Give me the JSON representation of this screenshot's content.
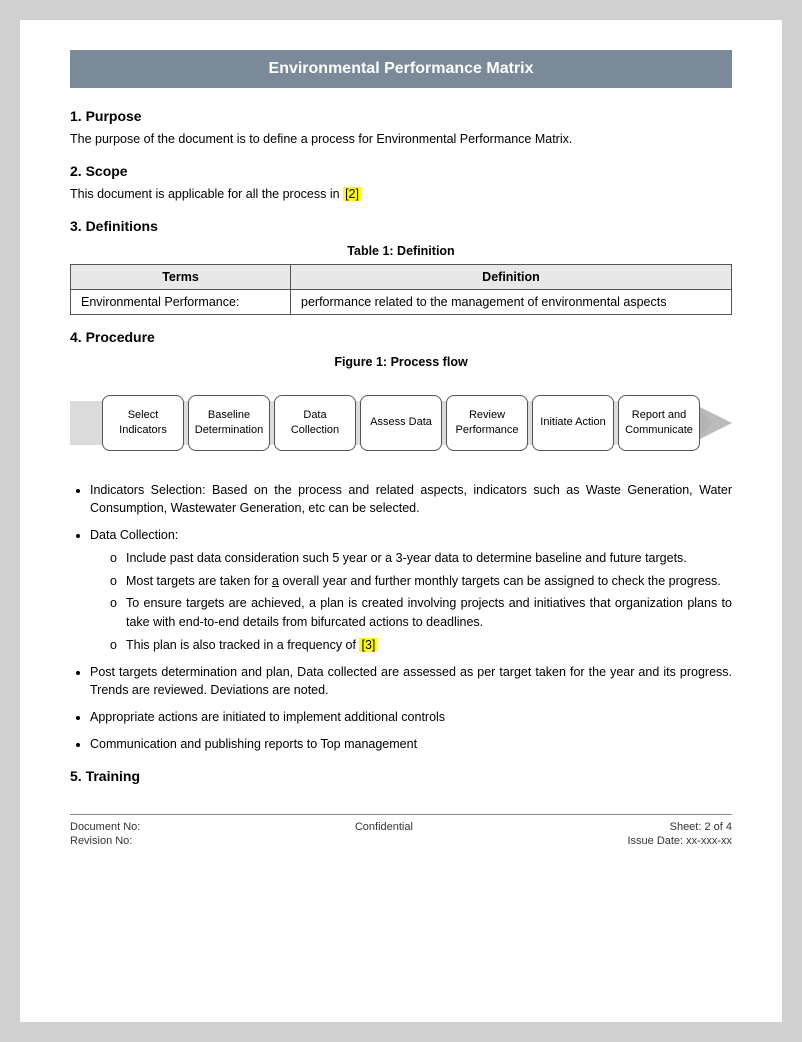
{
  "header": {
    "title": "Environmental Performance Matrix"
  },
  "sections": {
    "purpose": {
      "label": "1.  Purpose",
      "text": "The purpose of the document is to define a process for Environmental Performance Matrix."
    },
    "scope": {
      "label": "2.  Scope",
      "text_before": "This document is applicable for all the process in ",
      "highlight": "[2]",
      "text_after": ""
    },
    "definitions": {
      "label": "3.  Definitions",
      "table_caption": "Table 1: Definition",
      "table": {
        "headers": [
          "Terms",
          "Definition"
        ],
        "rows": [
          [
            "Environmental Performance:",
            "performance related to the management of environmental aspects"
          ]
        ]
      }
    },
    "procedure": {
      "label": "4.  Procedure",
      "figure_caption": "Figure 1: Process flow",
      "flow_boxes": [
        "Select\nIndicators",
        "Baseline\nDetermination",
        "Data\nCollection",
        "Assess Data",
        "Review\nPerformance",
        "Initiate Action",
        "Report and\nCommunicate"
      ],
      "bullets": [
        {
          "text": "Indicators Selection: Based on the process and related aspects, indicators such as Waste Generation, Water Consumption, Wastewater Generation, etc can be selected."
        },
        {
          "text": "Data Collection:",
          "sub": [
            "Include past data consideration such 5 year or a 3-year data to determine baseline and future targets.",
            "Most targets are taken for a overall year and further monthly targets can be assigned to check the progress.",
            "To ensure targets are achieved, a plan is created involving projects and initiatives that organization plans to take with end-to-end details from bifurcated actions to deadlines.",
            {
              "text_before": "This plan is also tracked in a frequency of ",
              "highlight": "[3]",
              "text_after": ""
            }
          ]
        },
        {
          "text": "Post targets determination and plan, Data collected are assessed as per target taken for the year and its progress. Trends are reviewed. Deviations are noted."
        },
        {
          "text": "Appropriate actions are initiated to implement additional controls"
        },
        {
          "text": "Communication and publishing reports to Top management"
        }
      ]
    },
    "training": {
      "label": "5.  Training"
    }
  },
  "footer": {
    "doc_no_label": "Document No:",
    "revision_label": "Revision No:",
    "confidential": "Confidential",
    "sheet": "Sheet: 2 of 4",
    "issue_date": "Issue Date: xx-xxx-xx"
  }
}
